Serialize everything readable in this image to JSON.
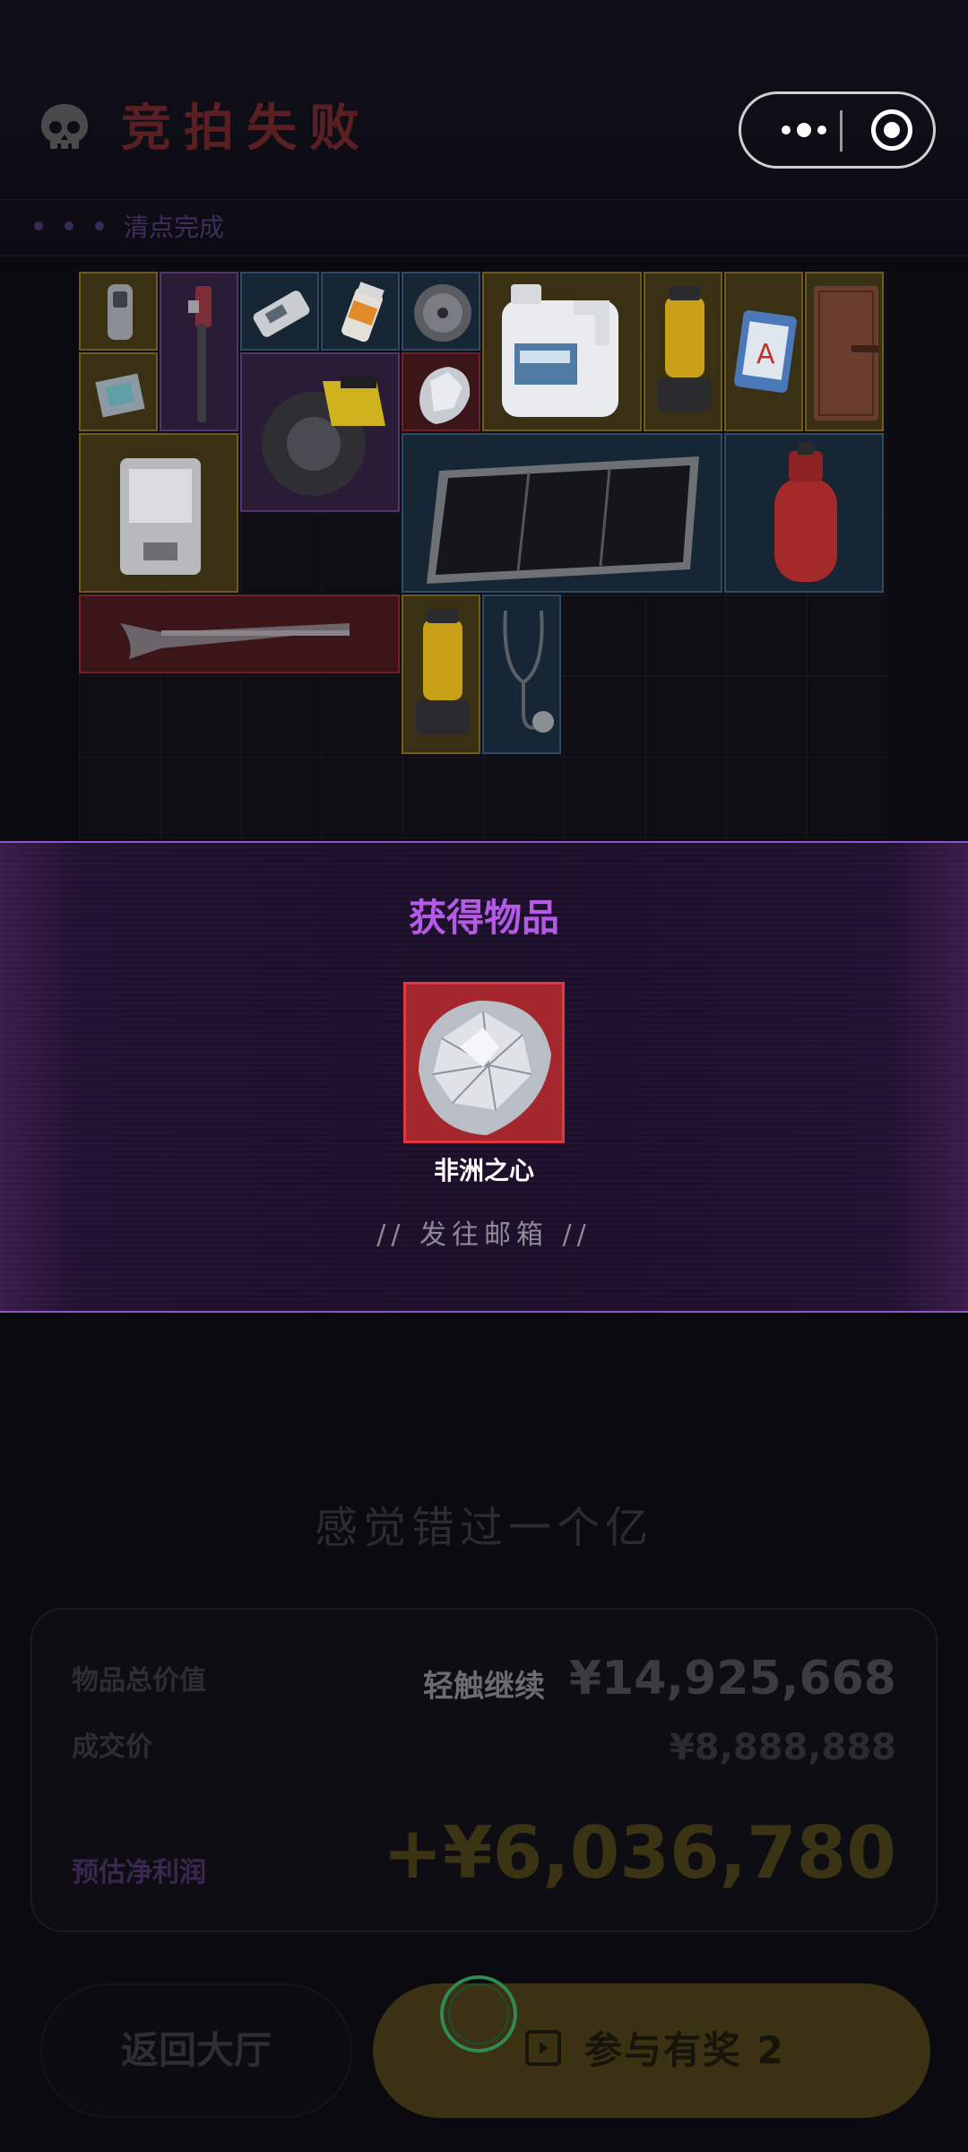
{
  "colors": {
    "background": "#0b0a10",
    "accent_purple": "#b45ae6",
    "popup_border": "#8b57c9",
    "rarity_gold": "#6f5b1e",
    "rarity_purple": "#53356c",
    "rarity_blue": "#2e4b63",
    "rarity_red": "#6e2329"
  },
  "header": {
    "icon": "skull-icon",
    "title": "竞拍失败",
    "status": "清点完成"
  },
  "capsule": {
    "more_icon": "more-dots-icon",
    "close_icon": "target-circle-icon"
  },
  "inventory": {
    "items": [
      {
        "rarity": "gold",
        "icon": "vape-device-icon"
      },
      {
        "rarity": "purple",
        "icon": "pipe-wrench-icon"
      },
      {
        "rarity": "blue",
        "icon": "handheld-device-icon"
      },
      {
        "rarity": "blue",
        "icon": "pill-bottle-icon"
      },
      {
        "rarity": "blue",
        "icon": "grinding-disc-icon"
      },
      {
        "rarity": "gold",
        "icon": "chemical-jug-icon"
      },
      {
        "rarity": "gold",
        "icon": "fuel-lantern-icon"
      },
      {
        "rarity": "gold",
        "icon": "medical-manual-icon"
      },
      {
        "rarity": "gold",
        "icon": "leather-notebook-icon"
      },
      {
        "rarity": "gold",
        "icon": "cpu-chip-icon"
      },
      {
        "rarity": "purple",
        "icon": "circular-saw-icon"
      },
      {
        "rarity": "red",
        "icon": "diamond-icon"
      },
      {
        "rarity": "gold",
        "icon": "tablet-case-icon"
      },
      {
        "rarity": "blue",
        "icon": "solar-panel-icon"
      },
      {
        "rarity": "blue",
        "icon": "gas-cylinder-icon"
      },
      {
        "rarity": "red",
        "icon": "antique-musket-icon"
      },
      {
        "rarity": "gold",
        "icon": "fuel-lantern-icon"
      },
      {
        "rarity": "blue",
        "icon": "stethoscope-icon"
      }
    ]
  },
  "popup": {
    "title": "获得物品",
    "item_name": "非洲之心",
    "item_rarity": "red",
    "item_icon": "diamond-icon",
    "note": "// 发往邮箱 //"
  },
  "slogan": "感觉错过一个亿",
  "summary": {
    "total_label": "物品总价值",
    "total_value": "¥14,925,668",
    "deal_label": "成交价",
    "deal_value": "¥8,888,888",
    "profit_label": "预估净利润",
    "profit_value": "+¥6,036,780",
    "tap_hint": "轻触继续"
  },
  "buttons": {
    "back_label": "返回大厅",
    "join_label": "参与有奖 2",
    "join_icon": "calendar-play-icon"
  }
}
